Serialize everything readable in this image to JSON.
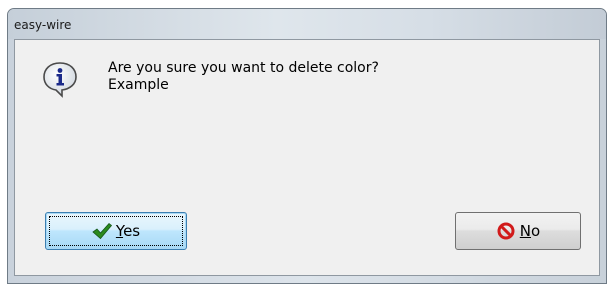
{
  "window": {
    "title": "easy-wire"
  },
  "dialog": {
    "icon": "info-icon",
    "message_line1": "Are you sure you want to delete color?",
    "message_line2": "Example"
  },
  "buttons": {
    "yes": {
      "accel": "Y",
      "rest": "es",
      "icon": "checkmark-icon"
    },
    "no": {
      "accel": "N",
      "rest": "o",
      "icon": "prohibited-icon"
    }
  },
  "colors": {
    "check_green": "#2a8a1e",
    "no_red": "#d11a1a"
  }
}
